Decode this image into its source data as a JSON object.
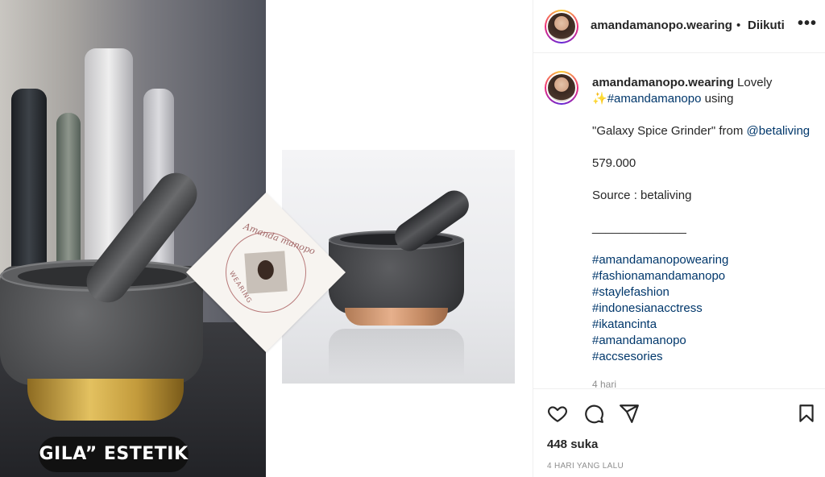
{
  "post": {
    "overlay_text": "GILA” ESTETIK",
    "logo_script": "Amanda manopo",
    "logo_word": "WEARING"
  },
  "header": {
    "username": "amandamanopo.wearing",
    "separator": "•",
    "follow_label": "Diikuti",
    "more_label": "•••"
  },
  "caption": {
    "username": "amandamanopo.wearing",
    "line1": " Lovely",
    "line2_emoji": "✨",
    "line2_tag": "#amandamanopo",
    "line2_rest": " using",
    "line3_text": "\"Galaxy Spice Grinder\" from ",
    "line3_mention": "@betaliving",
    "price": "579.000",
    "source": "Source : betaliving",
    "divider": "______________",
    "hashtags": [
      "#amandamanopowearing",
      "#fashionamandamanopo",
      "#staylefashion",
      "#indonesianacctress",
      "#ikatancinta",
      "#amandamanopo",
      "#accsesories"
    ],
    "time_ago": "4 hari"
  },
  "actions": {
    "icons": [
      "heart-icon",
      "comment-icon",
      "share-icon",
      "bookmark-icon"
    ]
  },
  "stats": {
    "likes": "448 suka",
    "posted": "4 HARI YANG LALU"
  },
  "colors": {
    "text": "#262626",
    "link": "#00376b",
    "muted": "#8e8e8e",
    "border": "#efefef"
  }
}
